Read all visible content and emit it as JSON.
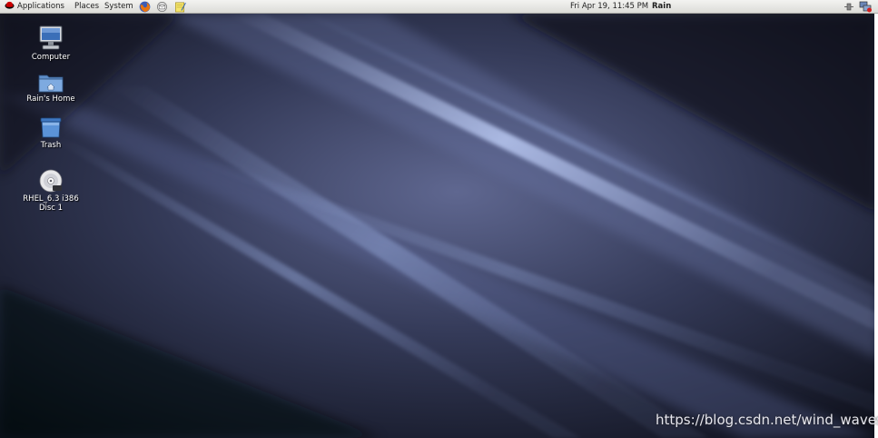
{
  "top_panel": {
    "menus": {
      "applications": "Applications",
      "places": "Places",
      "system": "System"
    },
    "launchers": [
      "firefox-icon",
      "email-icon",
      "notes-icon"
    ],
    "clock": "Fri Apr 19, 11:45 PM",
    "user": "Rain",
    "tray": [
      "volume-icon",
      "network-icon"
    ]
  },
  "desktop": {
    "icons": {
      "computer": "Computer",
      "home": "Rain's Home",
      "trash": "Trash",
      "disc": "RHEL_6.3 i386 Disc 1"
    }
  },
  "watermark": "https://blog.csdn.net/wind_waves",
  "colors": {
    "panel": "#e8e8e4",
    "desktop": "#1f2336",
    "highlight": "#9fb8e8"
  }
}
